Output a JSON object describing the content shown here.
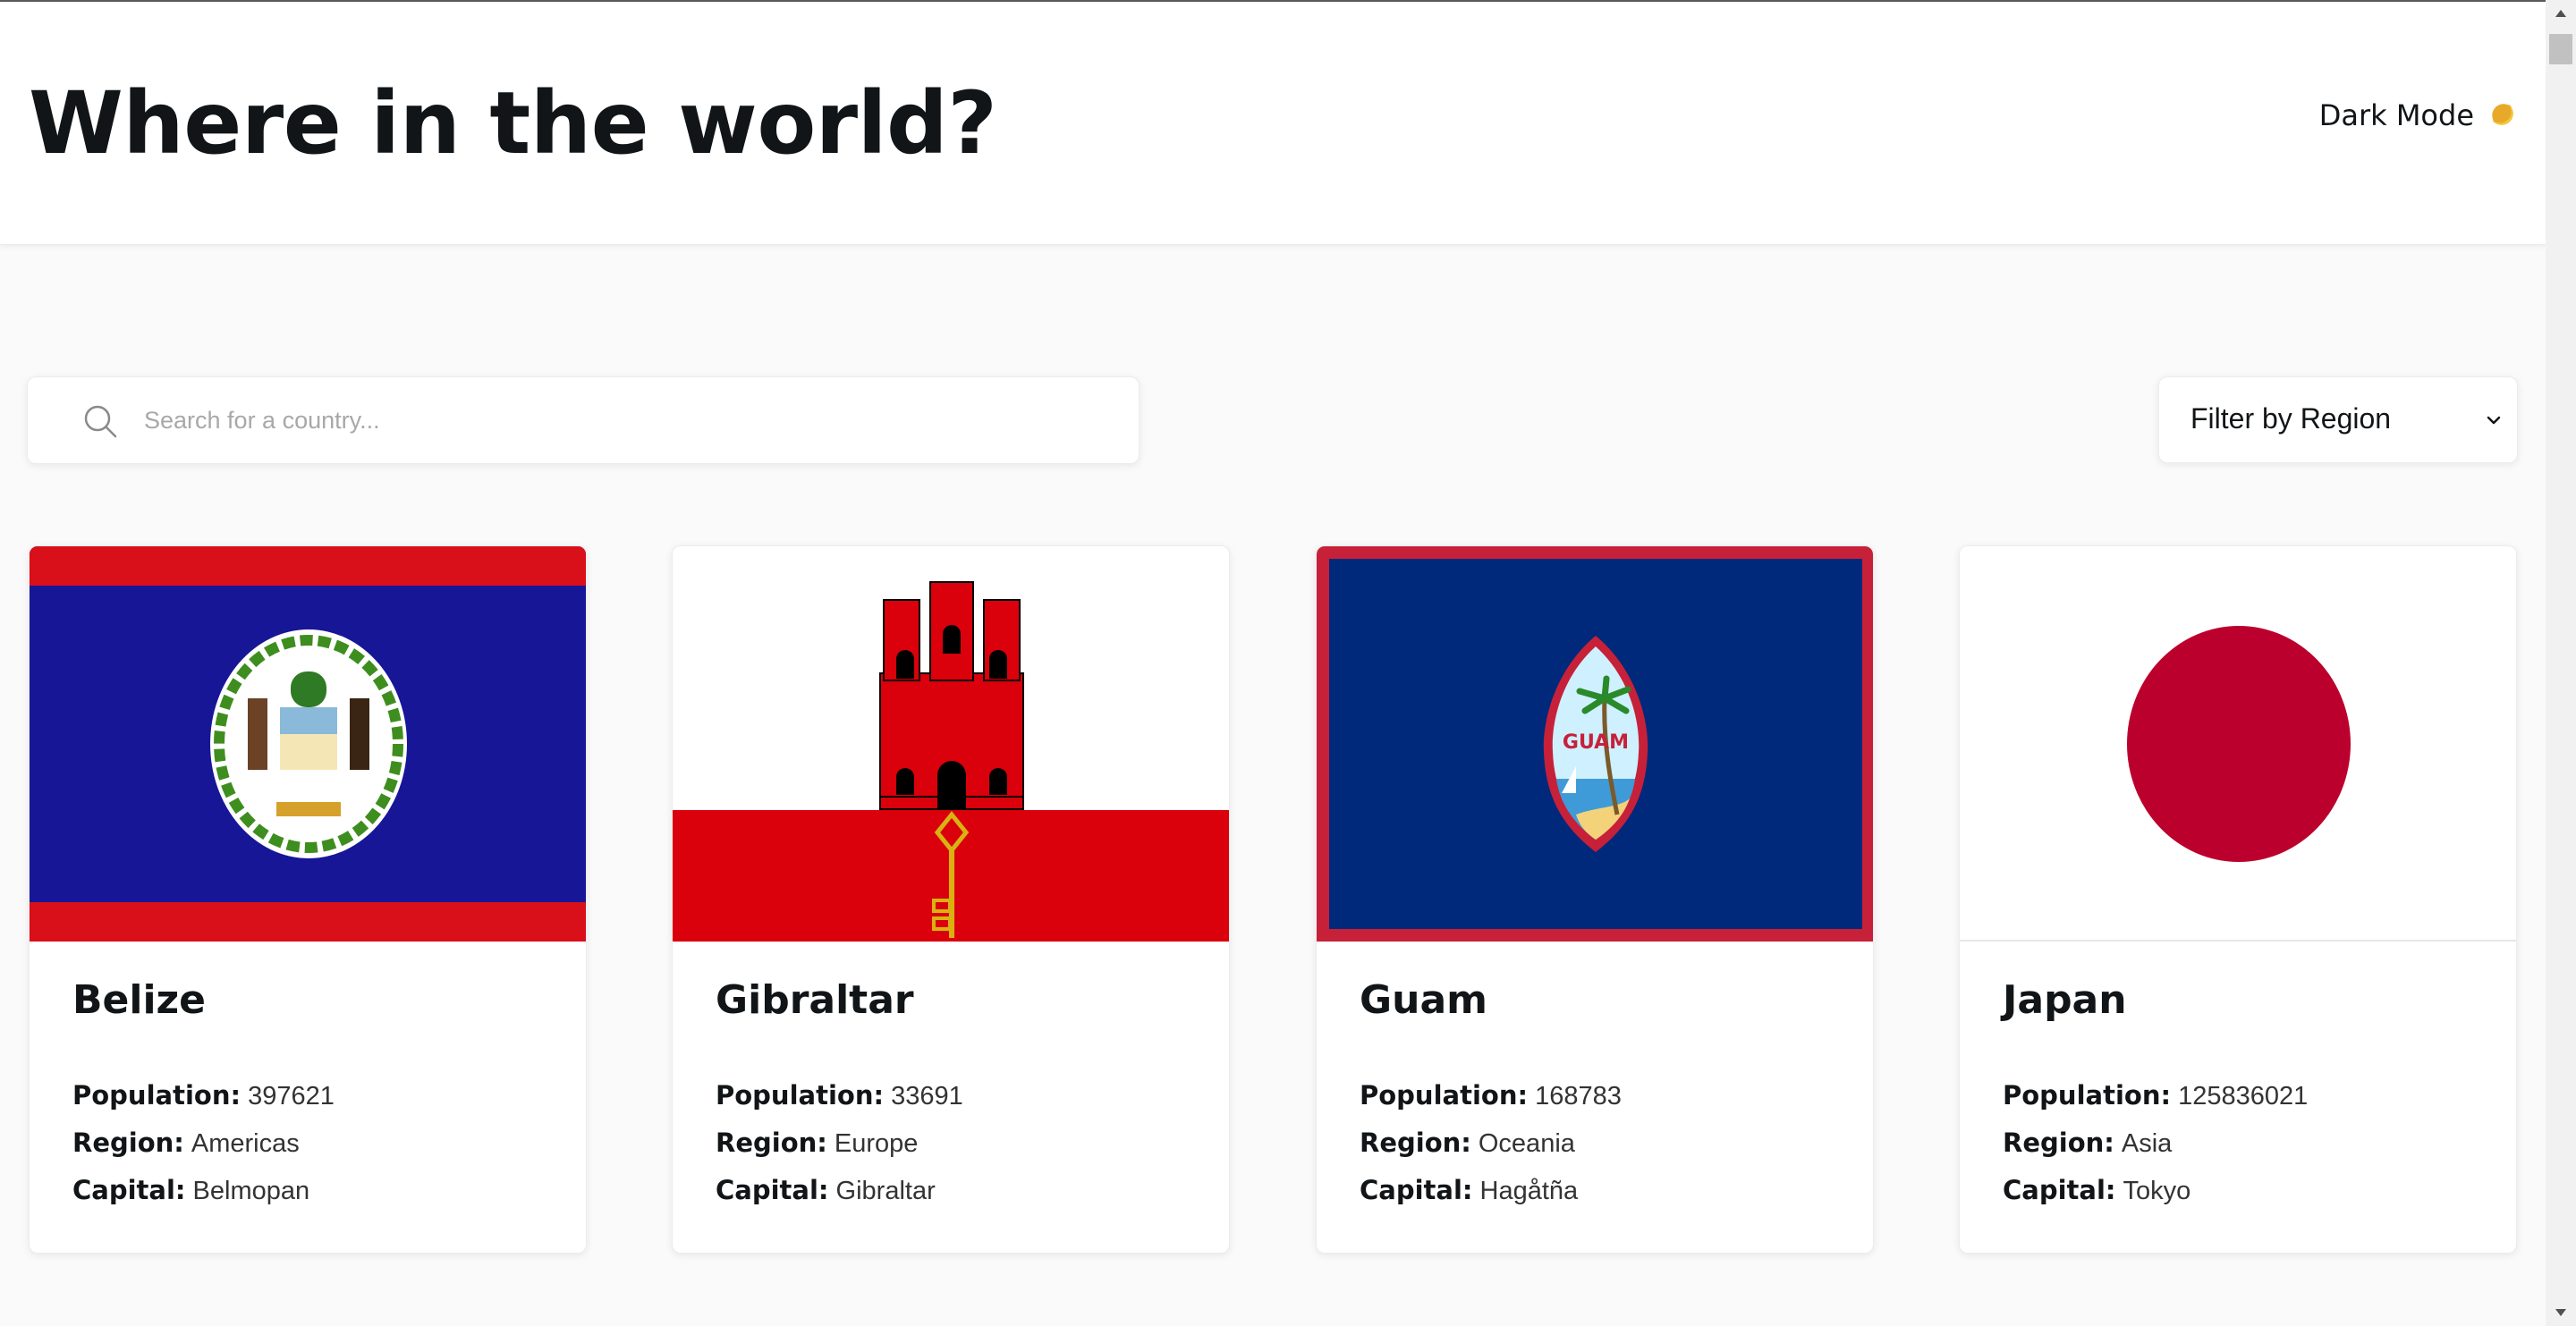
{
  "header": {
    "title": "Where in the world?",
    "dark_mode_label": "Dark Mode",
    "dark_mode_icon": "moon-icon"
  },
  "search": {
    "placeholder": "Search for a country...",
    "value": "",
    "icon": "search-icon"
  },
  "filter": {
    "label": "Filter by Region",
    "icon": "chevron-down-icon"
  },
  "labels": {
    "population": "Population:",
    "region": "Region:",
    "capital": "Capital:"
  },
  "countries": [
    {
      "name": "Belize",
      "population": "397621",
      "region": "Americas",
      "capital": "Belmopan",
      "flag_colors": [
        "#d90f19",
        "#171696",
        "#ffffff"
      ]
    },
    {
      "name": "Gibraltar",
      "population": "33691",
      "region": "Europe",
      "capital": "Gibraltar",
      "flag_colors": [
        "#ffffff",
        "#da000c",
        "#f8d80e"
      ]
    },
    {
      "name": "Guam",
      "population": "168783",
      "region": "Oceania",
      "capital": "Hagåtña",
      "flag_colors": [
        "#c62139",
        "#00297b",
        "#cef0ff"
      ]
    },
    {
      "name": "Japan",
      "population": "125836021",
      "region": "Asia",
      "capital": "Tokyo",
      "flag_colors": [
        "#ffffff",
        "#bc002d"
      ]
    }
  ]
}
